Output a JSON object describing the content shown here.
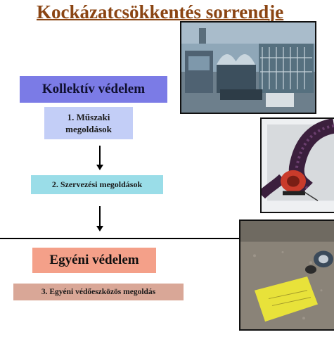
{
  "title": "Kockázatcsökkentés sorrendje",
  "sections": {
    "collective": {
      "heading": "Kollektív védelem"
    },
    "individual": {
      "heading": "Egyéni védelem"
    }
  },
  "steps": [
    {
      "label": "1. Műszaki megoldások"
    },
    {
      "label": "2. Szervezési megoldások"
    },
    {
      "label": "3. Egyéni védőeszközös megoldás"
    }
  ],
  "colors": {
    "title": "#8B4513",
    "collective_box": "#7B7BE6",
    "step1_box": "#C3CEF7",
    "step2_box": "#9ADDE8",
    "individual_box": "#F4A089",
    "step3_box": "#D9A797"
  },
  "images": [
    {
      "icon": "industrial-machinery-photo"
    },
    {
      "icon": "ventilation-fan-duct-photo"
    },
    {
      "icon": "protective-gear-on-floor-photo"
    }
  ]
}
